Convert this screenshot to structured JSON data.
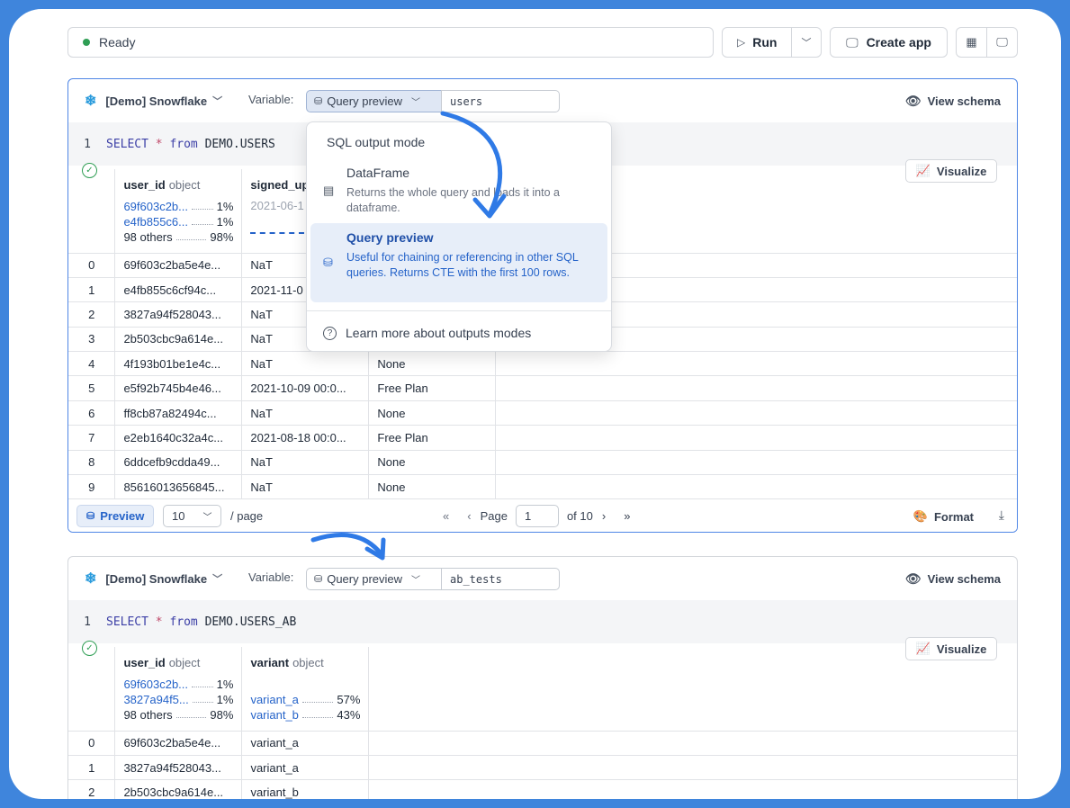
{
  "toolbar": {
    "status": "Ready",
    "run_label": "Run",
    "create_app_label": "Create app"
  },
  "colors": {
    "accent": "#2563c9",
    "arrow": "#2f7ae6",
    "success": "#2f9e54",
    "page_bg": "#3f85dc"
  },
  "cell1": {
    "connection": "[Demo] Snowflake",
    "variable_label": "Variable:",
    "mode": "Query preview",
    "variable": "users",
    "view_schema": "View schema",
    "line_no": "1",
    "sql": {
      "kw1": "SELECT",
      "op": "*",
      "kw2": "from",
      "table": "DEMO.USERS"
    },
    "visualize": "Visualize",
    "columns": [
      {
        "name": "user_id",
        "type": "object",
        "stats": [
          {
            "value": "69f603c2b...",
            "pct": "1%"
          },
          {
            "value": "e4fb855c6...",
            "pct": "1%"
          },
          {
            "value": "98 others",
            "pct": "98%"
          }
        ]
      },
      {
        "name": "signed_up",
        "date": "2021-06-1"
      }
    ],
    "rows": [
      {
        "idx": "0",
        "user_id": "69f603c2ba5e4e...",
        "signed_up": "NaT",
        "plan": ""
      },
      {
        "idx": "1",
        "user_id": "e4fb855c6cf94c...",
        "signed_up": "2021-11-0",
        "plan": ""
      },
      {
        "idx": "2",
        "user_id": "3827a94f528043...",
        "signed_up": "NaT",
        "plan": ""
      },
      {
        "idx": "3",
        "user_id": "2b503cbc9a614e...",
        "signed_up": "NaT",
        "plan": ""
      },
      {
        "idx": "4",
        "user_id": "4f193b01be1e4c...",
        "signed_up": "NaT",
        "plan": "None"
      },
      {
        "idx": "5",
        "user_id": "e5f92b745b4e46...",
        "signed_up": "2021-10-09 00:0...",
        "plan": "Free Plan"
      },
      {
        "idx": "6",
        "user_id": "ff8cb87a82494c...",
        "signed_up": "NaT",
        "plan": "None"
      },
      {
        "idx": "7",
        "user_id": "e2eb1640c32a4c...",
        "signed_up": "2021-08-18 00:0...",
        "plan": "Free Plan"
      },
      {
        "idx": "8",
        "user_id": "6ddcefb9cdda49...",
        "signed_up": "NaT",
        "plan": "None"
      },
      {
        "idx": "9",
        "user_id": "85616013656845...",
        "signed_up": "NaT",
        "plan": "None"
      }
    ],
    "footer": {
      "preview": "Preview",
      "page_size": "10",
      "per_page": "/ page",
      "page_label": "Page",
      "page": "1",
      "of_pages": "of 10",
      "format": "Format"
    }
  },
  "dropdown": {
    "title": "SQL output mode",
    "options": [
      {
        "title": "DataFrame",
        "desc": "Returns the whole query and loads it into a dataframe."
      },
      {
        "title": "Query preview",
        "desc": "Useful for chaining or referencing in other SQL queries. Returns CTE with the first 100 rows."
      }
    ],
    "learn_more": "Learn more about outputs modes"
  },
  "cell2": {
    "connection": "[Demo] Snowflake",
    "variable_label": "Variable:",
    "mode": "Query preview",
    "variable": "ab_tests",
    "view_schema": "View schema",
    "line_no": "1",
    "sql": {
      "kw1": "SELECT",
      "op": "*",
      "kw2": "from",
      "table": "DEMO.USERS_AB"
    },
    "visualize": "Visualize",
    "columns": [
      {
        "name": "user_id",
        "type": "object",
        "stats": [
          {
            "value": "69f603c2b...",
            "pct": "1%"
          },
          {
            "value": "3827a94f5...",
            "pct": "1%"
          },
          {
            "value": "98 others",
            "pct": "98%"
          }
        ]
      },
      {
        "name": "variant",
        "type": "object",
        "stats": [
          {
            "value": "variant_a",
            "pct": "57%"
          },
          {
            "value": "variant_b",
            "pct": "43%"
          }
        ]
      }
    ],
    "rows": [
      {
        "idx": "0",
        "user_id": "69f603c2ba5e4e...",
        "variant": "variant_a"
      },
      {
        "idx": "1",
        "user_id": "3827a94f528043...",
        "variant": "variant_a"
      },
      {
        "idx": "2",
        "user_id": "2b503cbc9a614e...",
        "variant": "variant_b"
      }
    ]
  }
}
